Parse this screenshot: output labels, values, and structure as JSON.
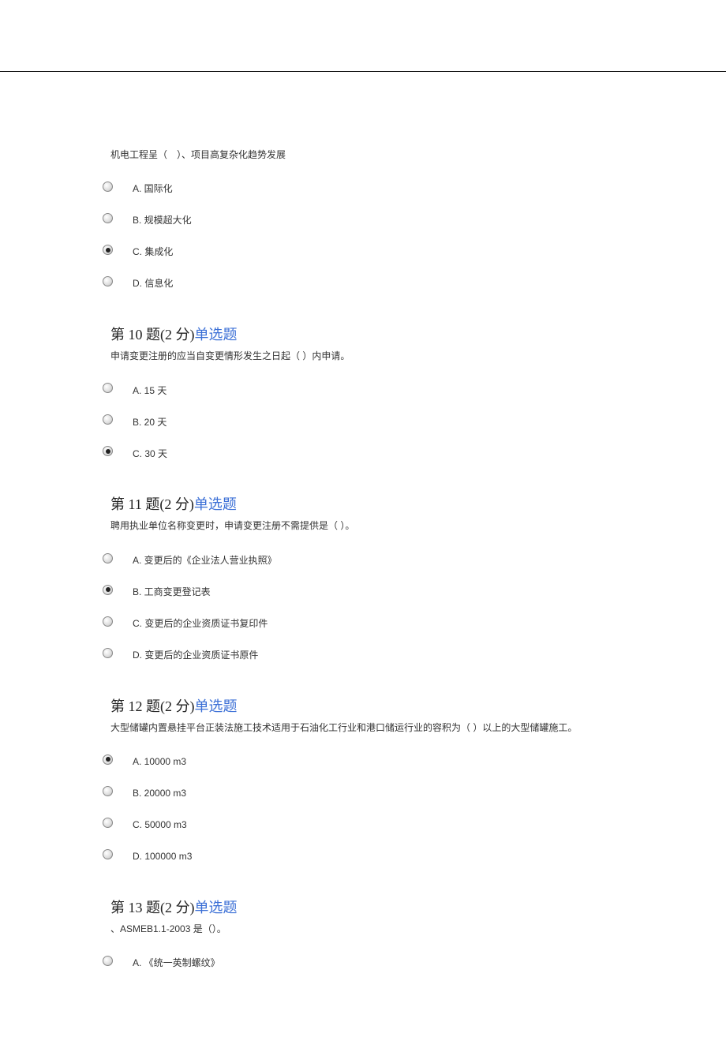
{
  "questions": [
    {
      "header_prefix": "",
      "header_type": "",
      "stem": "机电工程呈（　）、项目高复杂化趋势发展",
      "options": [
        {
          "label": "A. 国际化",
          "selected": false
        },
        {
          "label": "B. 规模超大化",
          "selected": false
        },
        {
          "label": "C. 集成化",
          "selected": true
        },
        {
          "label": "D. 信息化",
          "selected": false
        }
      ],
      "show_header": false
    },
    {
      "header_prefix": "第 10 题(2 分)",
      "header_type": "单选题",
      "stem": "申请变更注册的应当自变更情形发生之日起（ ）内申请。",
      "options": [
        {
          "label": "A. 15 天",
          "selected": false
        },
        {
          "label": "B. 20 天",
          "selected": false
        },
        {
          "label": "C. 30 天",
          "selected": true
        }
      ],
      "show_header": true
    },
    {
      "header_prefix": "第 11 题(2 分)",
      "header_type": "单选题",
      "stem": "聘用执业单位名称变更时，申请变更注册不需提供是（ ）。",
      "options": [
        {
          "label": "A. 变更后的《企业法人营业执照》",
          "selected": false
        },
        {
          "label": "B. 工商变更登记表",
          "selected": true
        },
        {
          "label": "C. 变更后的企业资质证书复印件",
          "selected": false
        },
        {
          "label": "D. 变更后的企业资质证书原件",
          "selected": false
        }
      ],
      "show_header": true
    },
    {
      "header_prefix": "第 12 题(2 分)",
      "header_type": "单选题",
      "stem": "大型储罐内置悬挂平台正装法施工技术适用于石油化工行业和港口储运行业的容积为（ ）以上的大型储罐施工。",
      "options": [
        {
          "label": "A. 10000 m3",
          "selected": true
        },
        {
          "label": "B. 20000 m3",
          "selected": false
        },
        {
          "label": "C. 50000 m3",
          "selected": false
        },
        {
          "label": "D.  100000 m3",
          "selected": false
        }
      ],
      "show_header": true
    },
    {
      "header_prefix": "第 13 题(2 分)",
      "header_type": "单选题",
      "stem": "、ASMEB1.1-2003 是（）。",
      "options": [
        {
          "label": "A. 《统一英制螺纹》",
          "selected": false
        }
      ],
      "show_header": true
    }
  ]
}
